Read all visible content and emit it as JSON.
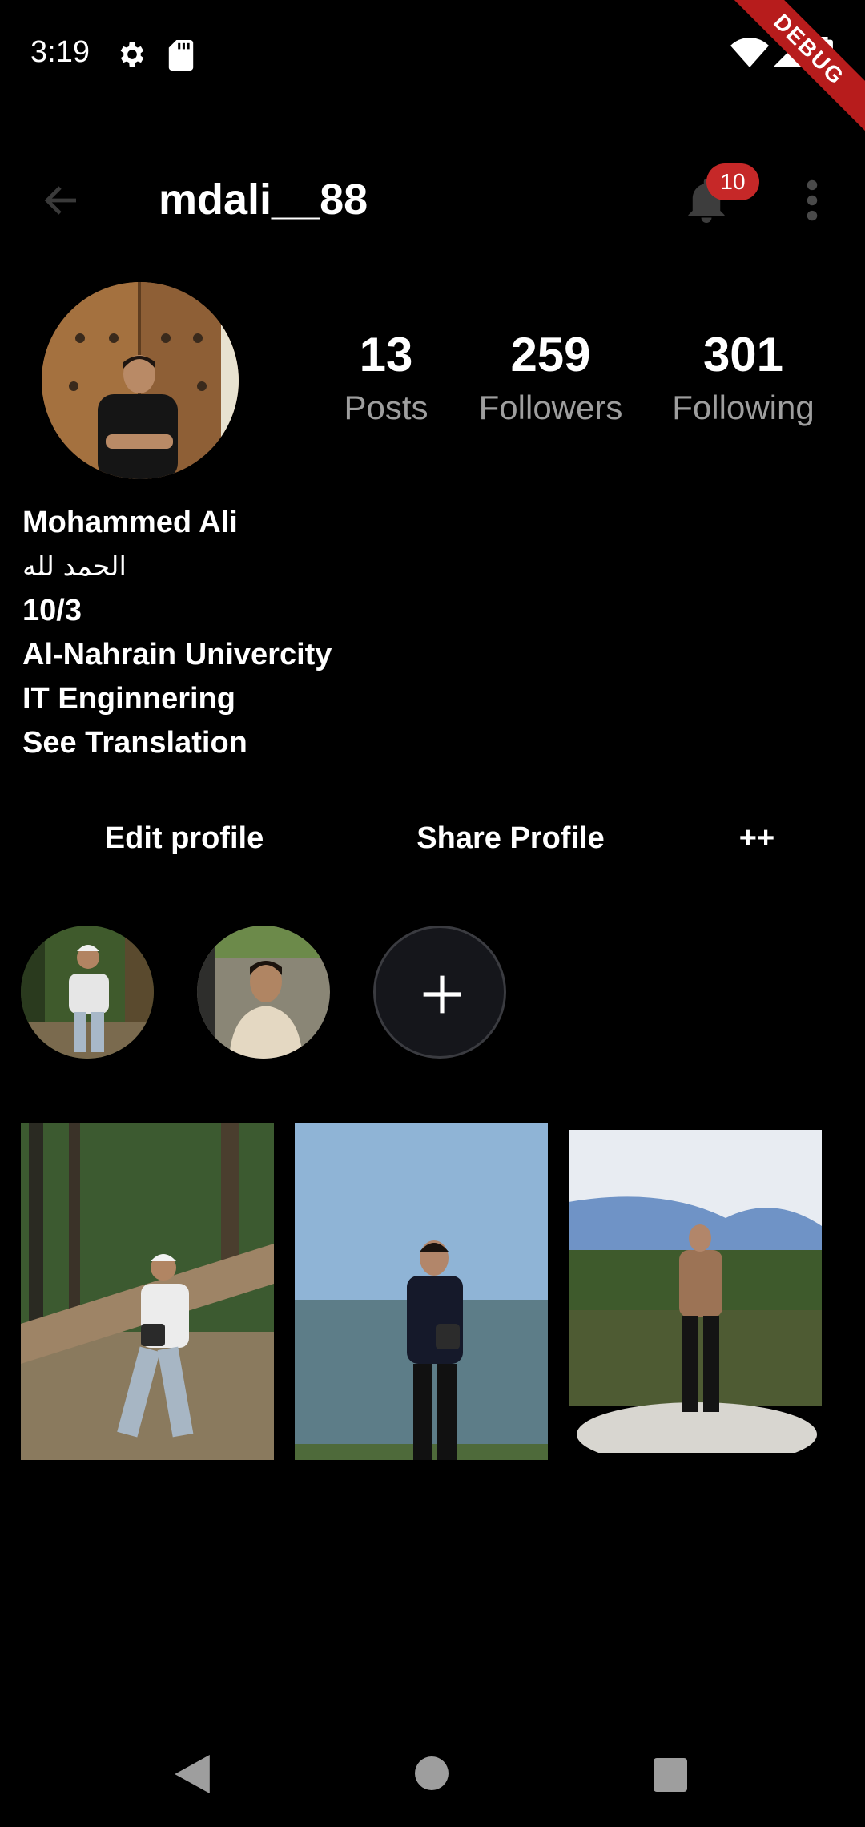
{
  "status_bar": {
    "time": "3:19",
    "debug_label": "DEBUG",
    "icons": [
      "gear-icon",
      "sd-card-icon",
      "wifi-icon",
      "signal-icon",
      "battery-icon"
    ]
  },
  "app_bar": {
    "username": "mdali__88",
    "notification_count": "10",
    "icons": [
      "back-arrow-icon",
      "bell-icon",
      "more-vert-icon"
    ]
  },
  "stats": {
    "posts_value": "13",
    "posts_label": "Posts",
    "followers_value": "259",
    "followers_label": "Followers",
    "following_value": "301",
    "following_label": "Following"
  },
  "bio": {
    "name": "Mohammed Ali",
    "line2": "الحمد لله",
    "line3": "10/3",
    "line4": "Al-Nahrain Univercity",
    "line5": "IT Enginnering",
    "see_translation": "See Translation"
  },
  "actions": {
    "edit_profile": "Edit profile",
    "share_profile": "Share Profile",
    "more": "++"
  },
  "highlights": [
    "forest-photo-highlight",
    "portrait-highlight",
    "add-highlight"
  ],
  "posts": [
    "forest-log-photo",
    "sea-shore-photo",
    "lake-rock-photo"
  ],
  "colors": {
    "background": "#000000",
    "badge": "#c62828",
    "secondary_text": "#9e9e9e",
    "debug_banner": "#b71c1c"
  }
}
